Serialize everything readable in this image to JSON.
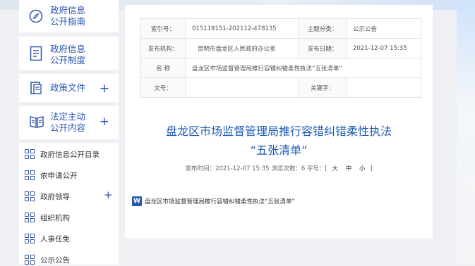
{
  "sidebar": {
    "cards": [
      {
        "label_line1": "政府信息",
        "label_line2": "公开指南",
        "icon": "compass-icon"
      },
      {
        "label_line1": "政府信息",
        "label_line2": "公开制度",
        "icon": "document-icon"
      },
      {
        "label_line1": "政策文件",
        "label_line2": "",
        "icon": "policy-icon",
        "plus": "+"
      },
      {
        "label_line1": "法定主动",
        "label_line2": "公开内容",
        "icon": "book-icon",
        "plus": "+"
      }
    ],
    "subitems": [
      {
        "label": "政府信息公开目录"
      },
      {
        "label": "依申请公开"
      },
      {
        "label": "政府领导",
        "plus": "+"
      },
      {
        "label": "组织机构"
      },
      {
        "label": "人事任免"
      },
      {
        "label": "公示公告"
      }
    ]
  },
  "meta": {
    "index_label": "索引号：",
    "index_value": "015119151-202112-478135",
    "topic_label": "主题分类：",
    "topic_value": "公示公告",
    "publisher_label": "发布机构：",
    "publisher_value": "昆明市盘龙区人民政府办公室",
    "date_label": "发布日期：",
    "date_value": "2021-12-07 15:35",
    "name_label": "名  称",
    "name_value": "盘龙区市场监督管理局推行容错纠错柔性执法“五张清单”",
    "docno_label": "文号：",
    "docno_value": "",
    "keyword_label": "关键字：",
    "keyword_value": ""
  },
  "article": {
    "title_line1": "盘龙区市场监督管理局推行容错纠错柔性执法",
    "title_line2": "“五张清单”",
    "info_prefix": "发布时间：2021-12-07 15:35 浏览次数：6 字号：[",
    "font_large": "大",
    "font_medium": "中",
    "font_small": "小",
    "info_suffix": "]",
    "attachment_icon_text": "W",
    "attachment_label": "盘龙区市场监督管理局推行容错纠错柔性执法“五张清单”"
  }
}
